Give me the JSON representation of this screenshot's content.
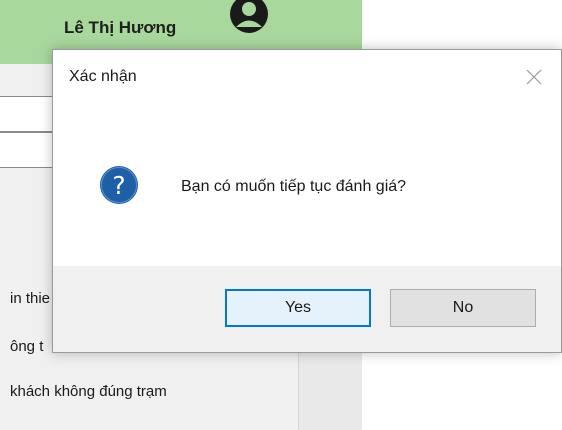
{
  "header": {
    "user_name": "Lê Thị Hương",
    "avatar_icon": "user-avatar-icon",
    "background_color": "#a9d89c"
  },
  "background_list": {
    "items": [
      "in thie",
      "ông t",
      "khách không đúng trạm"
    ]
  },
  "dialog": {
    "title": "Xác nhận",
    "close_icon": "close-icon",
    "icon": "question-icon",
    "icon_color": "#1f5fa8",
    "message": "Bạn có muốn tiếp tục đánh giá?",
    "buttons": {
      "yes_label": "Yes",
      "no_label": "No"
    },
    "accent_color": "#0078d7"
  }
}
